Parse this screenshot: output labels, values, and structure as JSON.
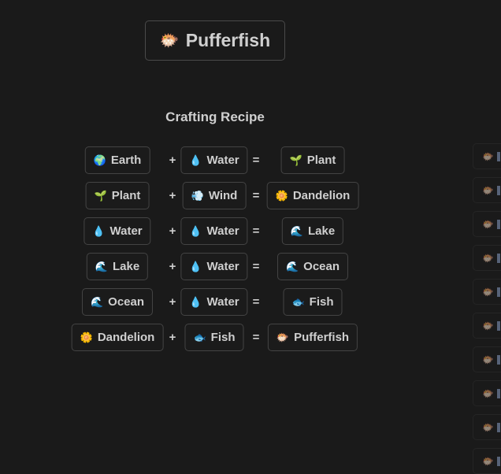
{
  "element": {
    "icon": "🐡",
    "name": "Pufferfish"
  },
  "heading": "Crafting Recipe",
  "operators": {
    "plus": "+",
    "equals": "="
  },
  "recipes": [
    {
      "a": {
        "icon": "🌍",
        "name": "Earth"
      },
      "b": {
        "icon": "💧",
        "name": "Water"
      },
      "result": {
        "icon": "🌱",
        "name": "Plant"
      }
    },
    {
      "a": {
        "icon": "🌱",
        "name": "Plant"
      },
      "b": {
        "icon": "💨",
        "name": "Wind"
      },
      "result": {
        "icon": "🌼",
        "name": "Dandelion"
      }
    },
    {
      "a": {
        "icon": "💧",
        "name": "Water"
      },
      "b": {
        "icon": "💧",
        "name": "Water"
      },
      "result": {
        "icon": "🌊",
        "name": "Lake"
      }
    },
    {
      "a": {
        "icon": "🌊",
        "name": "Lake"
      },
      "b": {
        "icon": "💧",
        "name": "Water"
      },
      "result": {
        "icon": "🌊",
        "name": "Ocean"
      }
    },
    {
      "a": {
        "icon": "🌊",
        "name": "Ocean"
      },
      "b": {
        "icon": "💧",
        "name": "Water"
      },
      "result": {
        "icon": "🐟",
        "name": "Fish"
      }
    },
    {
      "a": {
        "icon": "🌼",
        "name": "Dandelion"
      },
      "b": {
        "icon": "🐟",
        "name": "Fish"
      },
      "result": {
        "icon": "🐡",
        "name": "Pufferfish"
      }
    }
  ],
  "side_items": [
    {
      "icon": "🐡"
    },
    {
      "icon": "🐡"
    },
    {
      "icon": "🐡"
    },
    {
      "icon": "🐡"
    },
    {
      "icon": "🐡"
    },
    {
      "icon": "🐡"
    },
    {
      "icon": "🐡"
    },
    {
      "icon": "🐡"
    },
    {
      "icon": "🐡"
    },
    {
      "icon": "🐡"
    }
  ]
}
